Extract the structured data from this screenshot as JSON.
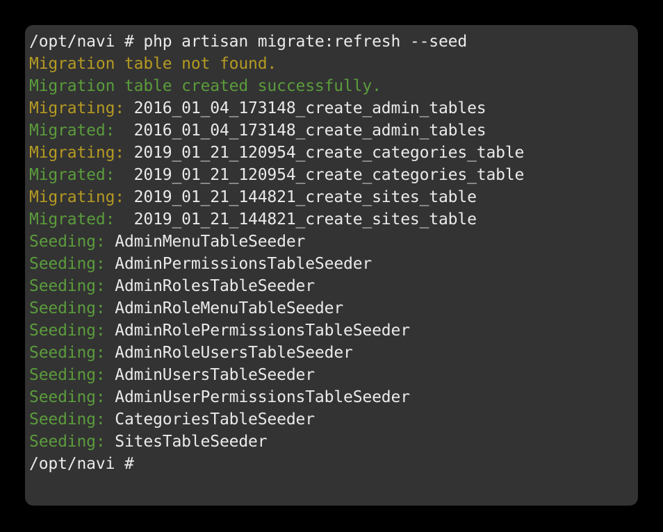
{
  "window": {
    "background_color": "#000000",
    "terminal_background": "#333333",
    "corner_radius_px": 12
  },
  "colors": {
    "default_text": "#eaeaea",
    "yellow": "#b59a23",
    "green": "#5b9c3c"
  },
  "terminal": {
    "prompt": "/opt/navi # ",
    "command": "php artisan migrate:refresh --seed",
    "lines": [
      {
        "kind": "prompt",
        "prompt": "/opt/navi # ",
        "text": "php artisan migrate:refresh --seed"
      },
      {
        "kind": "plain",
        "color": "yellow",
        "text": "Migration table not found."
      },
      {
        "kind": "plain",
        "color": "green",
        "text": "Migration table created successfully."
      },
      {
        "kind": "labeled",
        "color": "yellow",
        "label": "Migrating: ",
        "text": "2016_01_04_173148_create_admin_tables"
      },
      {
        "kind": "labeled",
        "color": "green",
        "label": "Migrated:  ",
        "text": "2016_01_04_173148_create_admin_tables"
      },
      {
        "kind": "labeled",
        "color": "yellow",
        "label": "Migrating: ",
        "text": "2019_01_21_120954_create_categories_table"
      },
      {
        "kind": "labeled",
        "color": "green",
        "label": "Migrated:  ",
        "text": "2019_01_21_120954_create_categories_table"
      },
      {
        "kind": "labeled",
        "color": "yellow",
        "label": "Migrating: ",
        "text": "2019_01_21_144821_create_sites_table"
      },
      {
        "kind": "labeled",
        "color": "green",
        "label": "Migrated:  ",
        "text": "2019_01_21_144821_create_sites_table"
      },
      {
        "kind": "labeled",
        "color": "green",
        "label": "Seeding: ",
        "text": "AdminMenuTableSeeder"
      },
      {
        "kind": "labeled",
        "color": "green",
        "label": "Seeding: ",
        "text": "AdminPermissionsTableSeeder"
      },
      {
        "kind": "labeled",
        "color": "green",
        "label": "Seeding: ",
        "text": "AdminRolesTableSeeder"
      },
      {
        "kind": "labeled",
        "color": "green",
        "label": "Seeding: ",
        "text": "AdminRoleMenuTableSeeder"
      },
      {
        "kind": "labeled",
        "color": "green",
        "label": "Seeding: ",
        "text": "AdminRolePermissionsTableSeeder"
      },
      {
        "kind": "labeled",
        "color": "green",
        "label": "Seeding: ",
        "text": "AdminRoleUsersTableSeeder"
      },
      {
        "kind": "labeled",
        "color": "green",
        "label": "Seeding: ",
        "text": "AdminUsersTableSeeder"
      },
      {
        "kind": "labeled",
        "color": "green",
        "label": "Seeding: ",
        "text": "AdminUserPermissionsTableSeeder"
      },
      {
        "kind": "labeled",
        "color": "green",
        "label": "Seeding: ",
        "text": "CategoriesTableSeeder"
      },
      {
        "kind": "labeled",
        "color": "green",
        "label": "Seeding: ",
        "text": "SitesTableSeeder"
      },
      {
        "kind": "prompt",
        "prompt": "/opt/navi # ",
        "text": ""
      }
    ]
  }
}
